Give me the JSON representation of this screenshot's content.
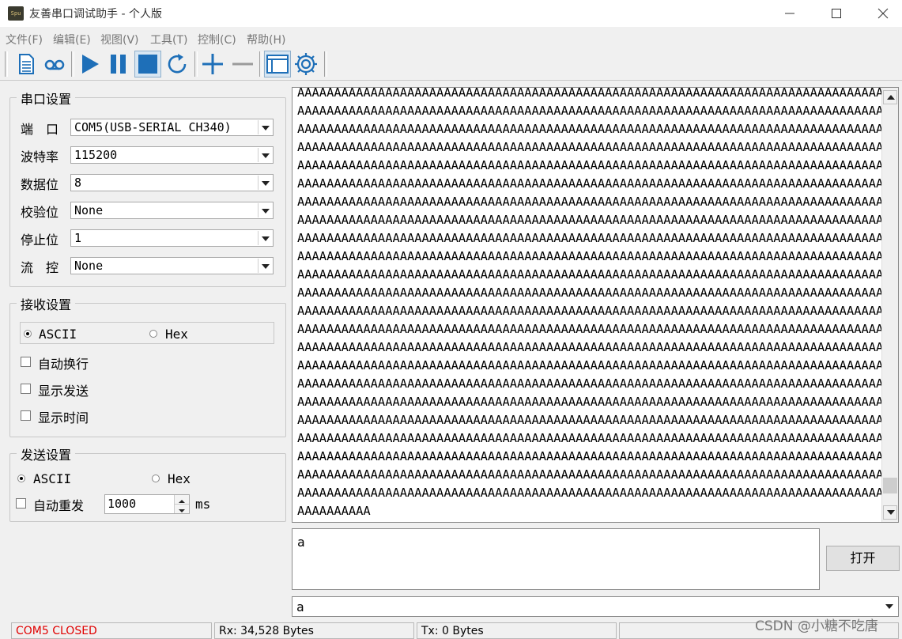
{
  "window": {
    "title": "友善串口调试助手 - 个人版",
    "icon_text": "Spu",
    "controls": [
      "minimize-icon",
      "maximize-icon",
      "close-icon"
    ]
  },
  "menu": {
    "items": [
      "文件(F)",
      "编辑(E)",
      "视图(V)",
      "工具(T)",
      "控制(C)",
      "帮助(H)"
    ]
  },
  "toolbar": {
    "buttons": [
      "new-file-icon",
      "record-icon",
      "play-icon",
      "pause-icon",
      "stop-icon",
      "refresh-icon",
      "plus-icon",
      "minus-icon",
      "window-icon",
      "settings-icon"
    ],
    "accent": "#1e6fb8"
  },
  "serial_settings": {
    "title": "串口设置",
    "rows": [
      {
        "label": "端　口",
        "value": "COM5(USB-SERIAL CH340)"
      },
      {
        "label": "波特率",
        "value": "115200"
      },
      {
        "label": "数据位",
        "value": "8"
      },
      {
        "label": "校验位",
        "value": "None"
      },
      {
        "label": "停止位",
        "value": "1"
      },
      {
        "label": "流　控",
        "value": "None"
      }
    ]
  },
  "receive_settings": {
    "title": "接收设置",
    "mode_ascii": "ASCII",
    "mode_hex": "Hex",
    "selected": "ASCII",
    "options": [
      {
        "label": "自动换行",
        "checked": false
      },
      {
        "label": "显示发送",
        "checked": false
      },
      {
        "label": "显示时间",
        "checked": false
      }
    ]
  },
  "send_settings": {
    "title": "发送设置",
    "mode_ascii": "ASCII",
    "mode_hex": "Hex",
    "selected": "ASCII",
    "auto_resend_label": "自动重发",
    "auto_resend_checked": false,
    "interval_value": "1000",
    "interval_unit": "ms"
  },
  "receive_area": {
    "line_text": "AAAAAAAAAAAAAAAAAAAAAAAAAAAAAAAAAAAAAAAAAAAAAAAAAAAAAAAAAAAAAAAAAAAAAAAAAAAAAAAAAAAAAA",
    "full_line_count": 23,
    "last_line": "AAAAAAAAAA",
    "scroll_position": 0.97
  },
  "send_area": {
    "text": "a",
    "open_button": "打开",
    "history_value": "a"
  },
  "status": {
    "port": "COM5 CLOSED",
    "rx": "Rx: 34,528 Bytes",
    "tx": "Tx: 0 Bytes",
    "port_color": "#e00000"
  },
  "watermark": "CSDN @小糖不吃唐"
}
